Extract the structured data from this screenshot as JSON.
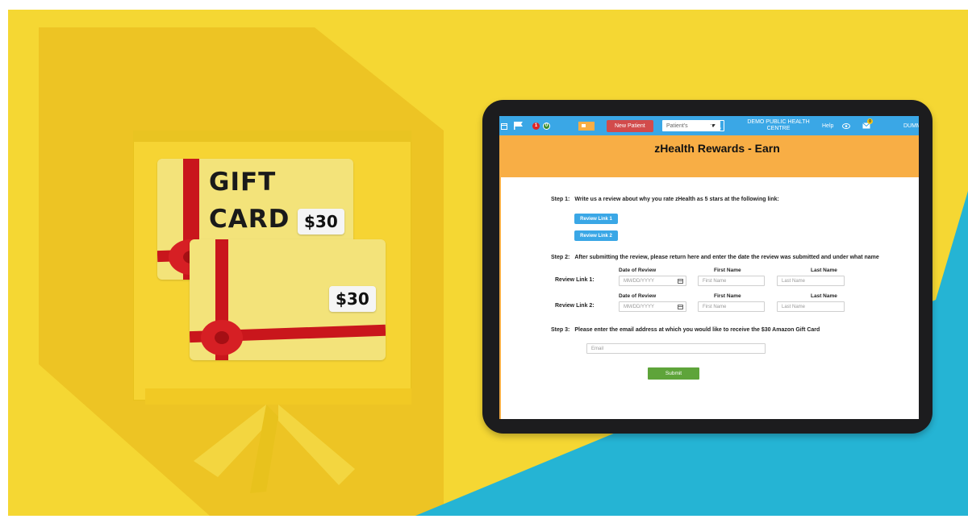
{
  "colors": {
    "background_yellow": "#f5d733",
    "background_blue": "#25b4d4",
    "appbar_blue": "#3aa7e6",
    "header_orange": "#f8ae45",
    "new_patient_red": "#d24b4b",
    "submit_green": "#5ea43a",
    "ribbon_red": "#c9161c"
  },
  "gift_cards": {
    "title_line1": "GIFT",
    "title_line2": "CARD",
    "card1_price": "$30",
    "card2_price": "$30"
  },
  "app": {
    "header": {
      "notification_count_red": "1",
      "notification_count_green": "0",
      "new_patient_label": "New Patient",
      "patient_select_value": "Patient's",
      "org_name_line1": "DEMO PUBLIC HEALTH",
      "org_name_line2": "CENTRE",
      "help_label": "Help",
      "messages_count": "0",
      "user_label": "DUMM"
    },
    "page_title": "zHealth Rewards - Earn",
    "step1": {
      "number": "Step 1:",
      "text": "Write us a review about why you rate zHealth as 5 stars at the following link:",
      "link1_label": "Review Link 1",
      "link2_label": "Review Link 2"
    },
    "step2": {
      "number": "Step 2:",
      "text": "After submitting the review, please return here and enter the date the review was submitted and under what name",
      "col_date": "Date of Review",
      "col_first": "First Name",
      "col_last": "Last Name",
      "row1_label": "Review Link 1:",
      "row2_label": "Review Link 2:",
      "date_placeholder": "MM/DD/YYYY",
      "first_placeholder": "First Name",
      "last_placeholder": "Last Name"
    },
    "step3": {
      "number": "Step 3:",
      "text": "Please enter the email address at which you would like to receive the $30 Amazon Gift Card",
      "email_placeholder": "Email"
    },
    "submit_label": "Submit"
  }
}
